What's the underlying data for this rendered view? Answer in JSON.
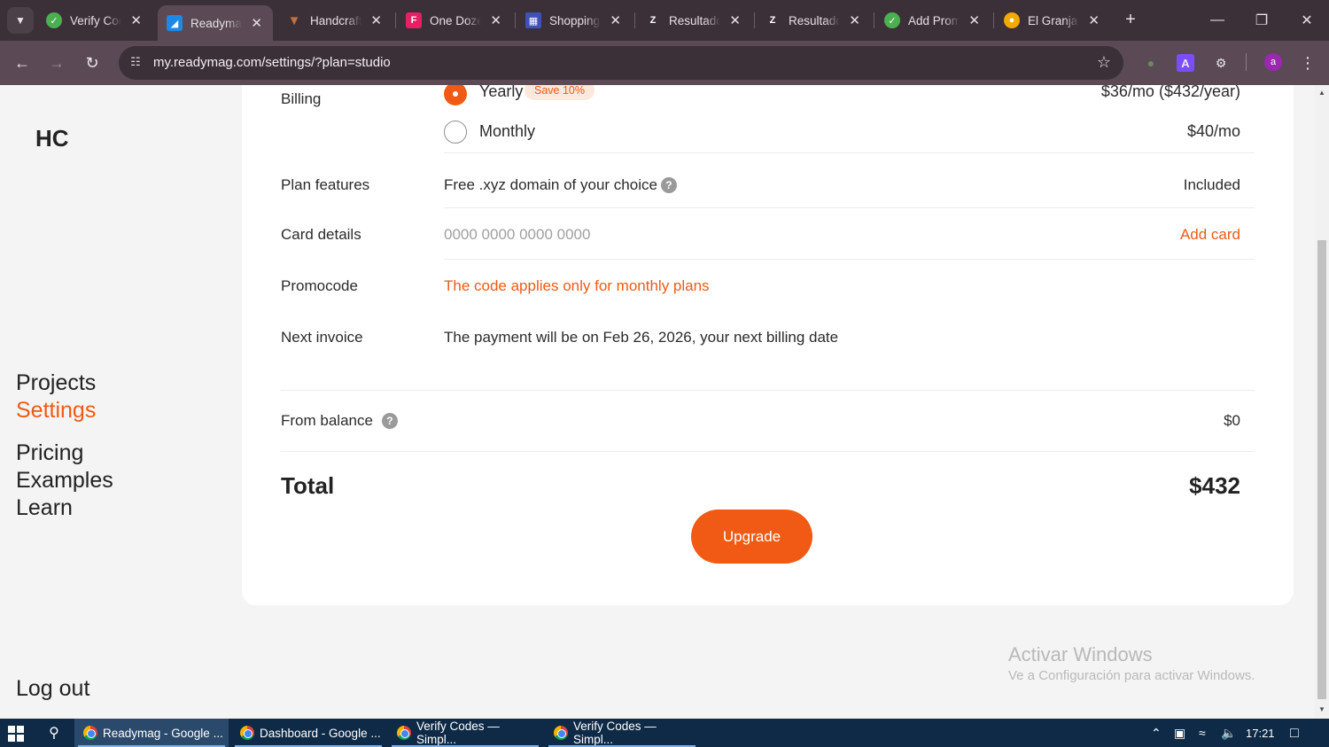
{
  "browser": {
    "tabs": [
      {
        "title": "Verify Codes",
        "icon": "green-check-icon",
        "color": "#4caf50"
      },
      {
        "title": "Readymag",
        "icon": "readymag-icon",
        "color": "#1e88e5"
      },
      {
        "title": "Handcrafted",
        "icon": "shield-icon",
        "color": "#b5632b"
      },
      {
        "title": "One Dozen",
        "icon": "f-logo-icon",
        "color": "#e91e63"
      },
      {
        "title": "Shopping",
        "icon": "checker-icon",
        "color": "#3f51b5"
      },
      {
        "title": "Resultados",
        "icon": "z-icon",
        "color": "#444444"
      },
      {
        "title": "Resultados",
        "icon": "z-icon",
        "color": "#444444"
      },
      {
        "title": "Add Promo",
        "icon": "green-check-icon",
        "color": "#4caf50"
      },
      {
        "title": "El Granjazo",
        "icon": "granjazo-icon",
        "color": "#f2a900"
      }
    ],
    "url": "my.readymag.com/settings/?plan=studio",
    "profile_initial": "a"
  },
  "sidebar": {
    "brand": "HC",
    "nav": [
      "Projects",
      "Settings",
      "Pricing",
      "Examples",
      "Learn"
    ],
    "logout": "Log out"
  },
  "billing": {
    "label": "Billing",
    "yearly": {
      "label": "Yearly",
      "badge": "Save 10%",
      "price": "$36/mo ($432/year)",
      "selected": true
    },
    "monthly": {
      "label": "Monthly",
      "price": "$40/mo",
      "selected": false
    }
  },
  "plan_features": {
    "label": "Plan features",
    "value": "Free .xyz domain of your choice",
    "status": "Included"
  },
  "card_details": {
    "label": "Card details",
    "placeholder": "0000 0000 0000 0000",
    "action": "Add card"
  },
  "promocode": {
    "label": "Promocode",
    "note": "The code applies only for monthly plans"
  },
  "next_invoice": {
    "label": "Next invoice",
    "value": "The payment will be on Feb 26, 2026, your next billing date"
  },
  "balance": {
    "label": "From balance",
    "value": "$0"
  },
  "total": {
    "label": "Total",
    "value": "$432"
  },
  "upgrade_label": "Upgrade",
  "watermark": {
    "line1": "Activar Windows",
    "line2": "Ve a Configuración para activar Windows."
  },
  "taskbar": {
    "apps": [
      "Readymag - Google ...",
      "Dashboard - Google ...",
      "Verify Codes — Simpl...",
      "Verify Codes — Simpl..."
    ],
    "clock": "17:21"
  },
  "colors": {
    "accent": "#f05a14",
    "chrome_dark": "#3b3038",
    "chrome": "#5b4a55",
    "taskbar": "#0e2a46"
  }
}
